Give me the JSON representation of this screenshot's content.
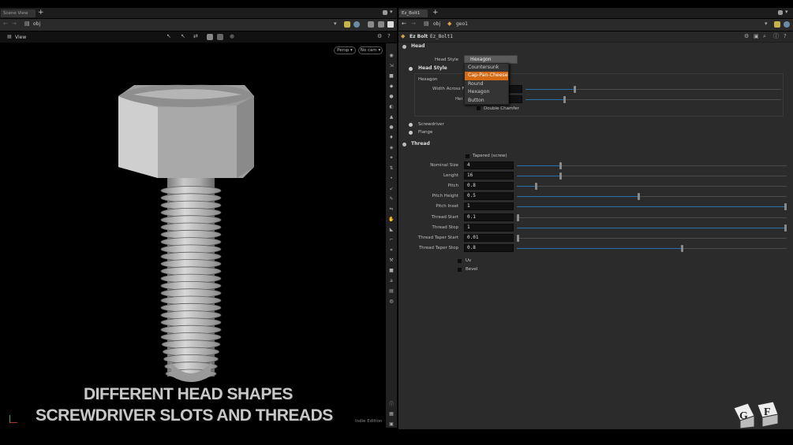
{
  "left_pane": {
    "tab_label": "Scene View",
    "path": "obj",
    "view_label": "View",
    "persp": "Persp ▾",
    "cam": "No cam ▾",
    "edition": "Indie Edition"
  },
  "right_pane": {
    "tab_label": "Ez_Bolt1",
    "path_obj": "obj",
    "path_geo": "geo1",
    "node_type": "Ez Bolt",
    "node_name": "Ez_Bolt1"
  },
  "head": {
    "section": "Head",
    "style_label": "Head Style",
    "style_value": "Hexagon",
    "folder": "Head Style",
    "sub": "Hexagon",
    "width_label": "Width Across F",
    "height_label": "Hei",
    "double_chamfer": "Double Chamfer",
    "options": [
      "Countersunk",
      "Cap-Pan-Cheese",
      "Round",
      "Hexagon",
      "Button"
    ],
    "highlighted": "Cap-Pan-Cheese",
    "width_slider": 0.19,
    "height_slider": 0.15
  },
  "folders": {
    "screwdriver": "Screwdriver",
    "flange": "Flange"
  },
  "thread": {
    "section": "Thread",
    "tapered": "Tapered (screw)",
    "params": [
      {
        "label": "Nominal Size",
        "value": "4",
        "slider": 0.16
      },
      {
        "label": "Lenght",
        "value": "16",
        "slider": 0.16
      },
      {
        "label": "Pitch",
        "value": "0.8",
        "slider": 0.07
      },
      {
        "label": "Pitch Height",
        "value": "0.5",
        "slider": 0.45
      },
      {
        "label": "Pitch Inset",
        "value": "1",
        "slider": 1.0
      },
      {
        "label": "Thread Start",
        "value": "0.1",
        "slider": 0.0
      },
      {
        "label": "Thread Stop",
        "value": "1",
        "slider": 1.0
      },
      {
        "label": "Thread Taper Start",
        "value": "0.01",
        "slider": 0.0
      },
      {
        "label": "Thread Taper Stop",
        "value": "0.8",
        "slider": 0.61
      }
    ],
    "uv": "Uv",
    "bevel": "Bevel"
  },
  "overlay": {
    "line1": "DIFFERENT HEAD SHAPES",
    "line2": "SCREWDRIVER SLOTS AND THREADS"
  },
  "colors": {
    "accent": "#d46a14",
    "slider_fill": "#2a6fb0"
  }
}
